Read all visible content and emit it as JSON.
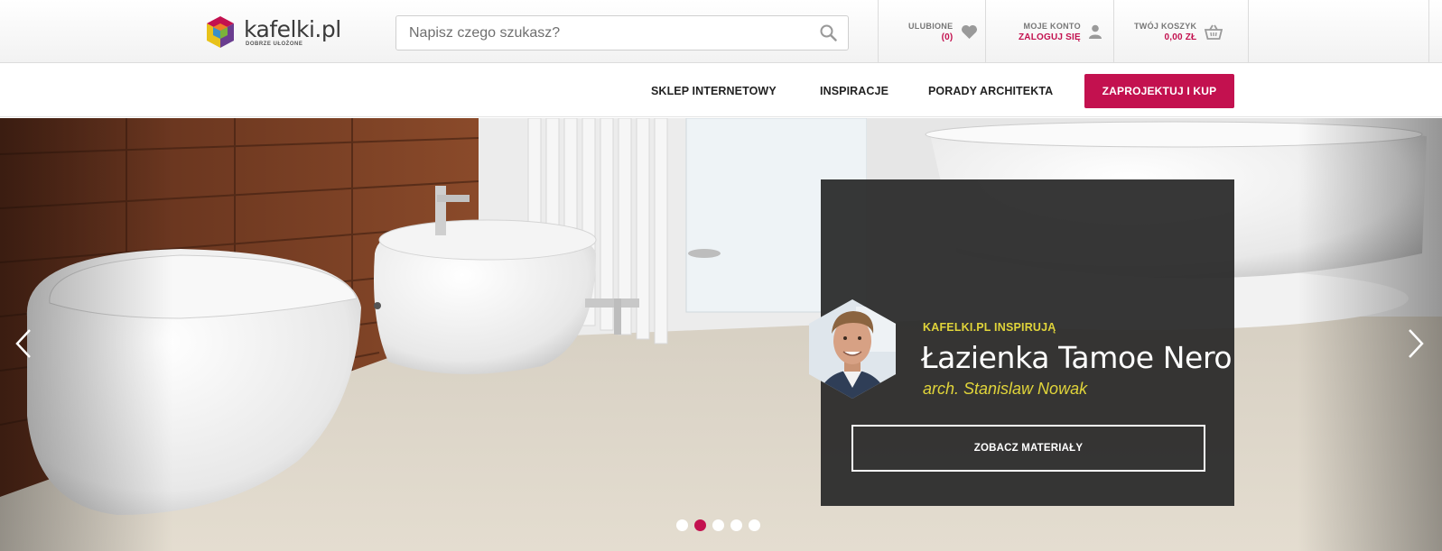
{
  "brand": {
    "name": "kafelki.pl",
    "tagline": "DOBRZE UŁOŻONE",
    "accent": "#c3114f"
  },
  "search": {
    "placeholder": "Napisz czego szukasz?",
    "value": ""
  },
  "header": {
    "favorites": {
      "label": "ULUBIONE",
      "count": "(0)",
      "icon": "heart-icon"
    },
    "account": {
      "label": "MOJE KONTO",
      "action": "ZALOGUJ SIĘ",
      "icon": "user-icon"
    },
    "cart": {
      "label": "TWÓJ KOSZYK",
      "total": "0,00 ZŁ",
      "icon": "basket-icon"
    }
  },
  "nav": {
    "items": [
      "SKLEP INTERNETOWY",
      "INSPIRACJE",
      "PORADY ARCHITEKTA"
    ],
    "cta": "ZAPROJEKTUJ I KUP"
  },
  "hero": {
    "eyebrow": "KAFELKI.PL INSPIRUJĄ",
    "title": "Łazienka Tamoe Nero",
    "author": "arch. Stanislaw Nowak",
    "button": "ZOBACZ MATERIAŁY",
    "slides_total": 5,
    "active_slide": 2,
    "highlight_color": "#e0d43a"
  }
}
